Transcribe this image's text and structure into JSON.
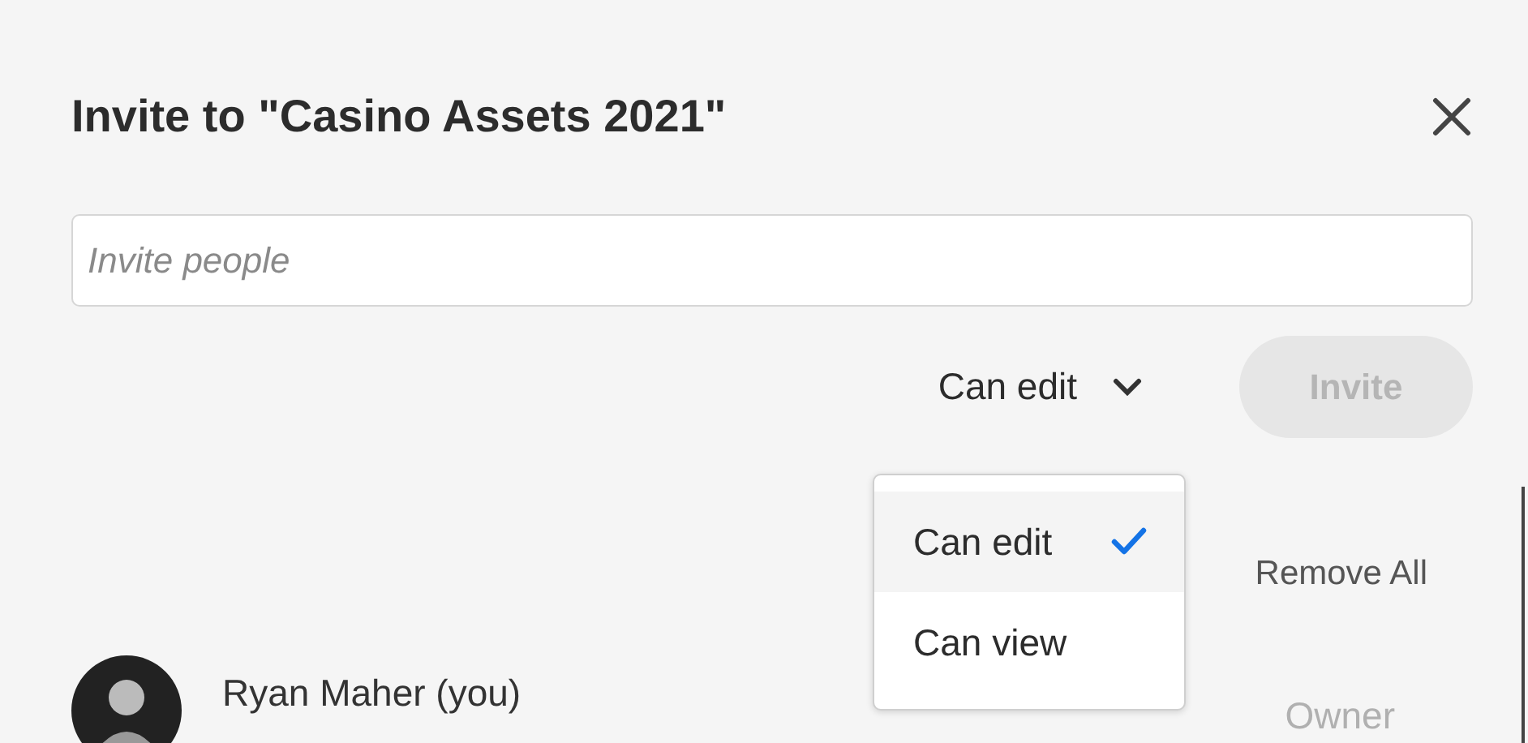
{
  "dialog": {
    "title": "Invite to \"Casino Assets 2021\"",
    "invite_field": {
      "placeholder": "Invite people"
    },
    "permission": {
      "value": "Can edit"
    },
    "invite_button": {
      "label": "Invite",
      "disabled": true
    },
    "permission_menu": {
      "items": [
        {
          "label": "Can edit",
          "selected": true
        },
        {
          "label": "Can view",
          "selected": false
        }
      ]
    },
    "remove_all": "Remove All",
    "members": [
      {
        "name": "Ryan Maher (you)",
        "role": "Owner"
      }
    ]
  }
}
